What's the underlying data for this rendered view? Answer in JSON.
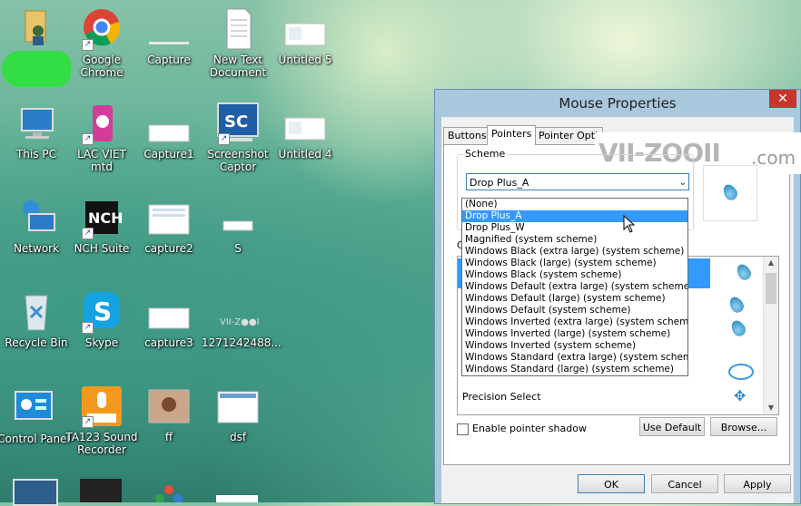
{
  "desktop_icons": [
    {
      "label": "",
      "icon": "user-folder-icon"
    },
    {
      "label": "Google Chrome",
      "icon": "chrome-icon"
    },
    {
      "label": "Capture",
      "icon": "image-file-icon"
    },
    {
      "label": "New Text Document",
      "icon": "text-file-icon"
    },
    {
      "label": "Untitled 5",
      "icon": "image-file-icon"
    },
    {
      "label": "This PC",
      "icon": "computer-icon"
    },
    {
      "label": "LAC VIET mtd",
      "icon": "lacviet-icon"
    },
    {
      "label": "Capture1",
      "icon": "image-file-icon"
    },
    {
      "label": "Screenshot Captor",
      "icon": "screenshot-captor-icon"
    },
    {
      "label": "Untitled 4",
      "icon": "image-file-icon"
    },
    {
      "label": "Network",
      "icon": "network-icon"
    },
    {
      "label": "NCH Suite",
      "icon": "nch-icon"
    },
    {
      "label": "capture2",
      "icon": "image-file-icon"
    },
    {
      "label": "S",
      "icon": "image-file-icon"
    },
    {
      "label": "Recycle Bin",
      "icon": "recycle-bin-icon"
    },
    {
      "label": "Skype",
      "icon": "skype-icon"
    },
    {
      "label": "capture3",
      "icon": "image-file-icon"
    },
    {
      "label": "1271242488...",
      "icon": "image-file-icon"
    },
    {
      "label": "Control Panel",
      "icon": "control-panel-icon"
    },
    {
      "label": "TA123 Sound Recorder",
      "icon": "sound-recorder-icon"
    },
    {
      "label": "ff",
      "icon": "image-file-icon"
    },
    {
      "label": "dsf",
      "icon": "image-file-icon"
    }
  ],
  "dialog": {
    "title": "Mouse Properties",
    "close": "✕",
    "tabs": [
      "Buttons",
      "Pointers",
      "Pointer Optio"
    ],
    "watermark": {
      "brand": "VII-ZOOII",
      "tld": ".com"
    },
    "scheme_group_label": "Scheme",
    "scheme_selected": "Drop Plus_A",
    "scheme_options": [
      "(None)",
      "Drop Plus_A",
      "Drop Plus_W",
      "Magnified (system scheme)",
      "Windows Black (extra large) (system scheme)",
      "Windows Black (large) (system scheme)",
      "Windows Black (system scheme)",
      "Windows Default (extra large) (system scheme)",
      "Windows Default (large) (system scheme)",
      "Windows Default (system scheme)",
      "Windows Inverted (extra large) (system scheme)",
      "Windows Inverted (large) (system scheme)",
      "Windows Inverted (system scheme)",
      "Windows Standard (extra large) (system scheme)",
      "Windows Standard (large) (system scheme)"
    ],
    "customize_label": "Cu",
    "cursor_list_visible_item": "Precision Select",
    "pointer_shadow_label": "Enable pointer shadow",
    "pointer_shadow_checked": false,
    "use_default_label": "Use Default",
    "browse_label": "Browse...",
    "ok_label": "OK",
    "cancel_label": "Cancel",
    "apply_label": "Apply"
  },
  "colors": {
    "accent": "#3399ff",
    "close": "#c7352b",
    "frame": "#a9c7dd"
  }
}
